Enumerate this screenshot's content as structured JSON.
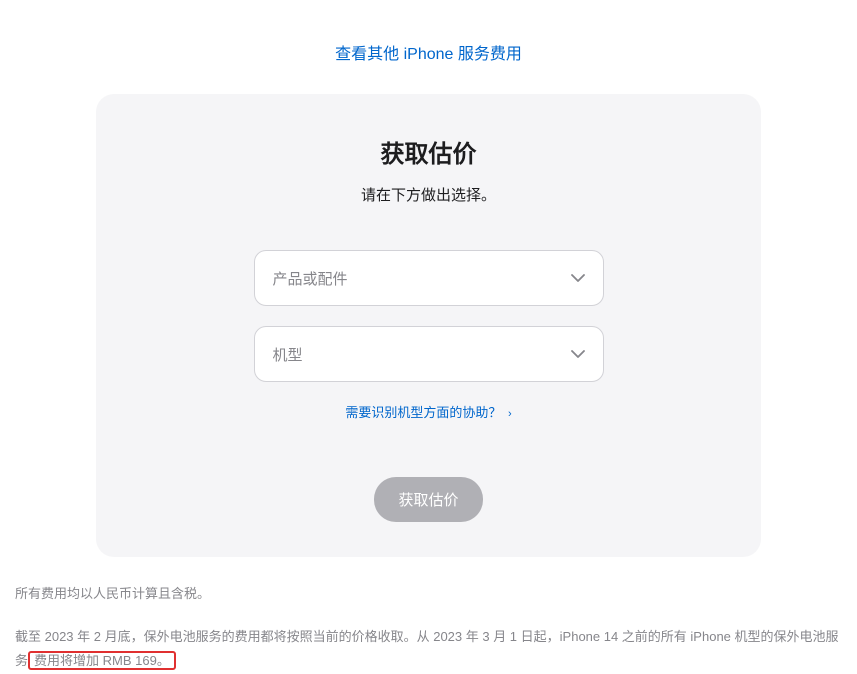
{
  "topLink": "查看其他 iPhone 服务费用",
  "card": {
    "title": "获取估价",
    "subtitle": "请在下方做出选择。",
    "selectProduct": "产品或配件",
    "selectModel": "机型",
    "helpLink": "需要识别机型方面的协助？",
    "submitButton": "获取估价"
  },
  "footnotes": {
    "note1": "所有费用均以人民币计算且含税。",
    "note2_part1": "截至 2023 年 2 月底，保外电池服务的费用都将按照当前的价格收取。从 2023 年 3 月 1 日起，iPhone 14 之前的所有 iPhone 机型的保外电池服务",
    "note2_highlight": "费用将增加 RMB 169。"
  }
}
